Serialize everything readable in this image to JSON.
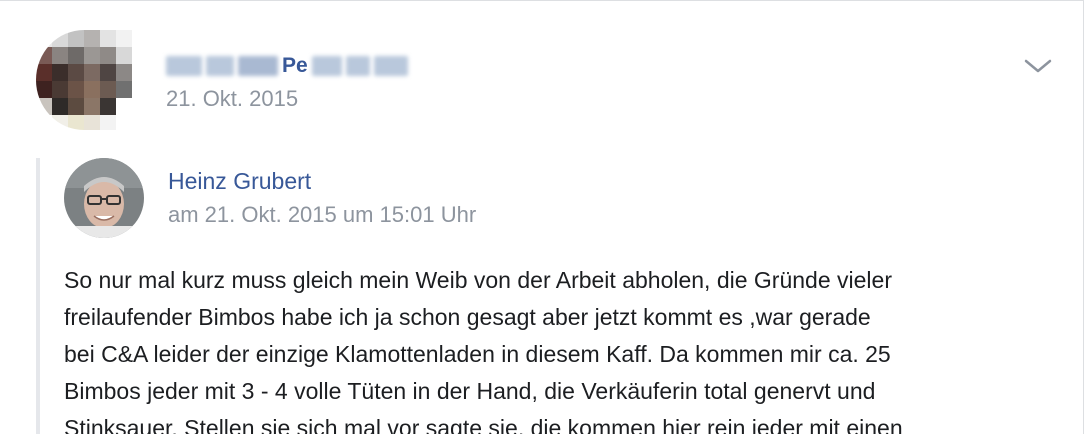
{
  "post": {
    "author_visible_part": "Pe",
    "date": "21. Okt. 2015"
  },
  "quoted": {
    "name": "Heinz Grubert",
    "date": "am 21. Okt. 2015 um 15:01 Uhr",
    "lines": [
      "So nur mal kurz muss gleich mein Weib von der Arbeit abholen, die Gründe vieler",
      "freilaufender Bimbos habe ich ja schon gesagt aber jetzt kommt es ,war gerade",
      "bei C&A leider der einzige Klamottenladen in diesem Kaff. Da kommen mir ca. 25",
      "Bimbos jeder mit 3 - 4 volle Tüten in der Hand, die Verkäuferin total genervt und",
      "Stinksauer. Stellen sie sich mal vor sagte sie, die kommen hier rein jeder mit einen"
    ]
  },
  "icons": {
    "options": "chevron-down-icon"
  },
  "colors": {
    "link": "#385898",
    "meta": "#8d949e",
    "text": "#1c1e21",
    "quote_bar": "#e5e7eb"
  }
}
